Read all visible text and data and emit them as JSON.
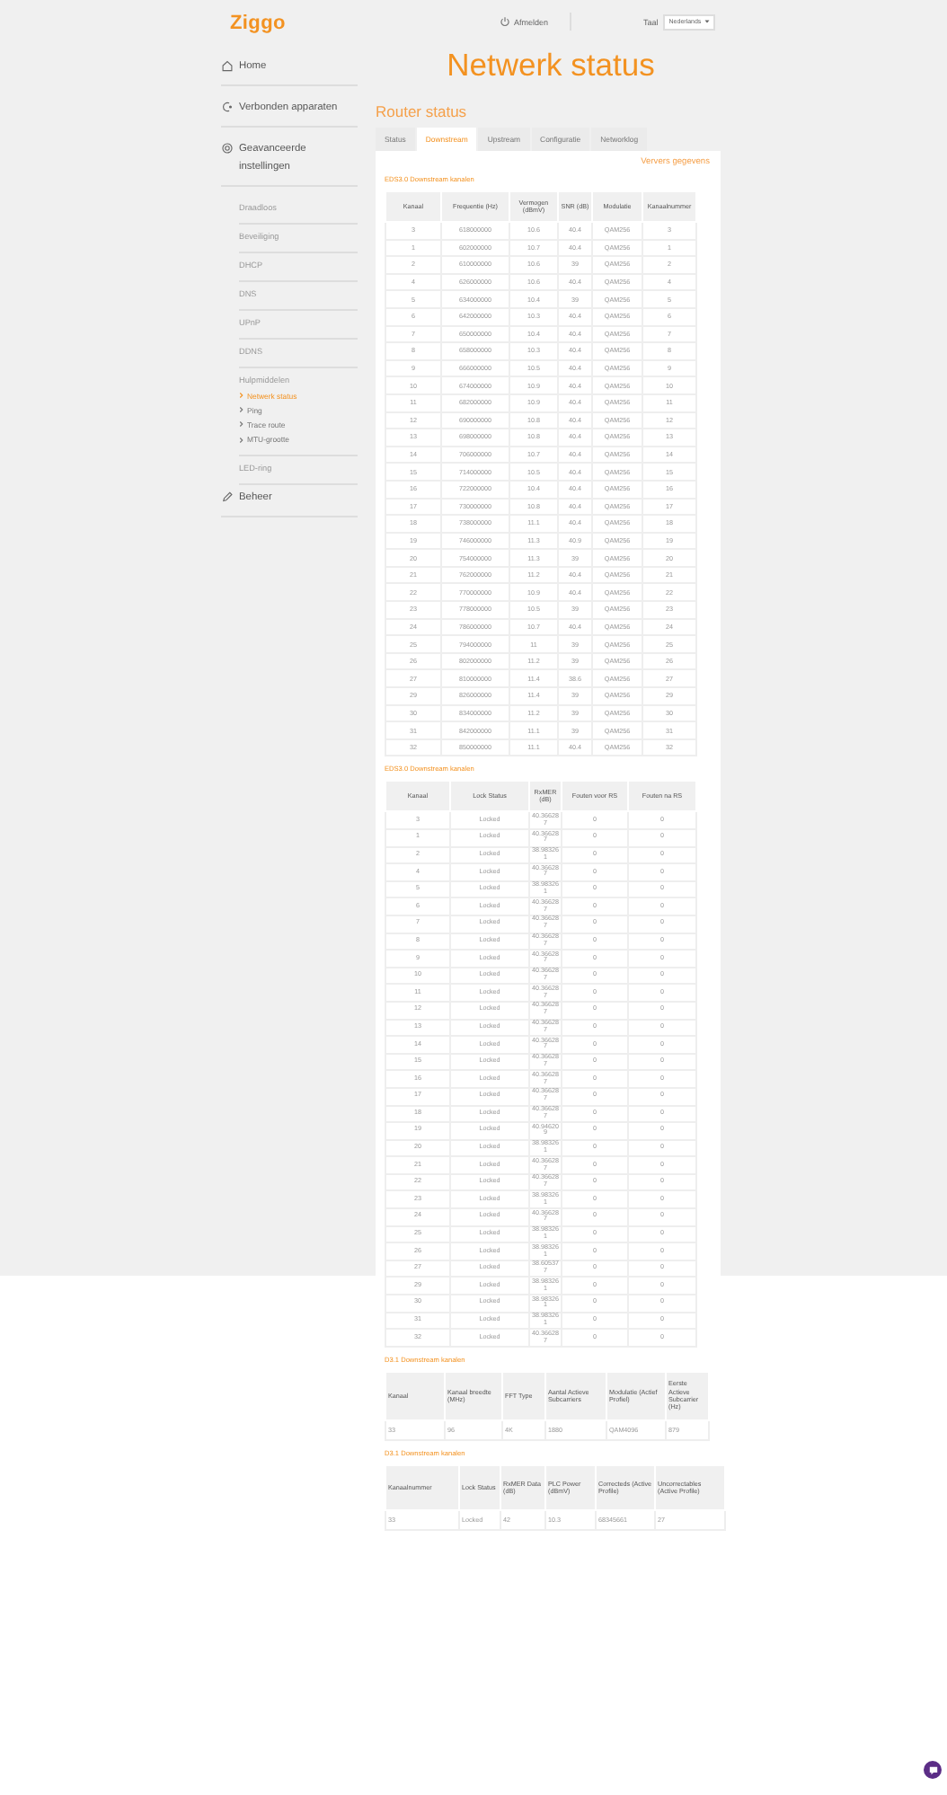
{
  "header": {
    "logo": "Ziggo",
    "logout": "Afmelden",
    "language_label": "Taal",
    "language_select": "Nederlands"
  },
  "page_title": "Netwerk status",
  "sidebar": {
    "items": [
      {
        "kind": "home",
        "label": "Home"
      },
      {
        "kind": "devices",
        "label": "Verbonden apparaten"
      },
      {
        "kind": "settings",
        "label": "Geavanceerde instellingen",
        "children": [
          {
            "kind": "page",
            "label": "Draadloos"
          },
          {
            "kind": "page",
            "label": "Beveiliging"
          },
          {
            "kind": "page",
            "label": "DHCP"
          },
          {
            "kind": "page",
            "label": "DNS"
          },
          {
            "kind": "page",
            "label": "UPnP"
          },
          {
            "kind": "page",
            "label": "DDNS"
          },
          {
            "kind": "group",
            "label": "Hulpmiddelen",
            "children": [
              {
                "kind": "tool",
                "label": "Netwerk status",
                "selected": true
              },
              {
                "kind": "tool",
                "label": "Ping",
                "selected": false
              },
              {
                "kind": "tool",
                "label": "Trace route",
                "selected": false
              },
              {
                "kind": "tool",
                "label": "MTU-grootte",
                "selected": false
              }
            ]
          },
          {
            "kind": "page",
            "label": "LED-ring"
          }
        ]
      },
      {
        "kind": "admin",
        "label": "Beheer"
      }
    ]
  },
  "section_title": "Router status",
  "tabs": [
    {
      "label": "Status",
      "selected": false
    },
    {
      "label": "Downstream",
      "selected": true
    },
    {
      "label": "Upstream",
      "selected": false
    },
    {
      "label": "Configuratie",
      "selected": false
    },
    {
      "label": "Networklog",
      "selected": false
    }
  ],
  "refresh_link": "Ververs gegevens",
  "tables": [
    {
      "title": "EDS3.0 Downstream kanalen",
      "kind": "qam",
      "columns": [
        "Kanaal",
        "Frequentie (Hz)",
        "Vermogen (dBmV)",
        "SNR (dB)",
        "Modulatie",
        "Kanaalnummer"
      ],
      "rows": [
        [
          "3",
          "618000000",
          "10.6",
          "40.4",
          "QAM256",
          "3"
        ],
        [
          "1",
          "602000000",
          "10.7",
          "40.4",
          "QAM256",
          "1"
        ],
        [
          "2",
          "610000000",
          "10.6",
          "39",
          "QAM256",
          "2"
        ],
        [
          "4",
          "626000000",
          "10.6",
          "40.4",
          "QAM256",
          "4"
        ],
        [
          "5",
          "634000000",
          "10.4",
          "39",
          "QAM256",
          "5"
        ],
        [
          "6",
          "642000000",
          "10.3",
          "40.4",
          "QAM256",
          "6"
        ],
        [
          "7",
          "650000000",
          "10.4",
          "40.4",
          "QAM256",
          "7"
        ],
        [
          "8",
          "658000000",
          "10.3",
          "40.4",
          "QAM256",
          "8"
        ],
        [
          "9",
          "666000000",
          "10.5",
          "40.4",
          "QAM256",
          "9"
        ],
        [
          "10",
          "674000000",
          "10.9",
          "40.4",
          "QAM256",
          "10"
        ],
        [
          "11",
          "682000000",
          "10.9",
          "40.4",
          "QAM256",
          "11"
        ],
        [
          "12",
          "690000000",
          "10.8",
          "40.4",
          "QAM256",
          "12"
        ],
        [
          "13",
          "698000000",
          "10.8",
          "40.4",
          "QAM256",
          "13"
        ],
        [
          "14",
          "706000000",
          "10.7",
          "40.4",
          "QAM256",
          "14"
        ],
        [
          "15",
          "714000000",
          "10.5",
          "40.4",
          "QAM256",
          "15"
        ],
        [
          "16",
          "722000000",
          "10.4",
          "40.4",
          "QAM256",
          "16"
        ],
        [
          "17",
          "730000000",
          "10.8",
          "40.4",
          "QAM256",
          "17"
        ],
        [
          "18",
          "738000000",
          "11.1",
          "40.4",
          "QAM256",
          "18"
        ],
        [
          "19",
          "746000000",
          "11.3",
          "40.9",
          "QAM256",
          "19"
        ],
        [
          "20",
          "754000000",
          "11.3",
          "39",
          "QAM256",
          "20"
        ],
        [
          "21",
          "762000000",
          "11.2",
          "40.4",
          "QAM256",
          "21"
        ],
        [
          "22",
          "770000000",
          "10.9",
          "40.4",
          "QAM256",
          "22"
        ],
        [
          "23",
          "778000000",
          "10.5",
          "39",
          "QAM256",
          "23"
        ],
        [
          "24",
          "786000000",
          "10.7",
          "40.4",
          "QAM256",
          "24"
        ],
        [
          "25",
          "794000000",
          "11",
          "39",
          "QAM256",
          "25"
        ],
        [
          "26",
          "802000000",
          "11.2",
          "39",
          "QAM256",
          "26"
        ],
        [
          "27",
          "810000000",
          "11.4",
          "38.6",
          "QAM256",
          "27"
        ],
        [
          "29",
          "826000000",
          "11.4",
          "39",
          "QAM256",
          "29"
        ],
        [
          "30",
          "834000000",
          "11.2",
          "39",
          "QAM256",
          "30"
        ],
        [
          "31",
          "842000000",
          "11.1",
          "39",
          "QAM256",
          "31"
        ],
        [
          "32",
          "850000000",
          "11.1",
          "40.4",
          "QAM256",
          "32"
        ]
      ]
    },
    {
      "title": "EDS3.0 Downstream kanalen",
      "kind": "mer",
      "columns": [
        "Kanaal",
        "Lock Status",
        "RxMER (dB)",
        "Fouten voor RS",
        "Fouten na RS"
      ],
      "rows": [
        [
          "3",
          "Locked",
          "40.366287",
          "0",
          "0"
        ],
        [
          "1",
          "Locked",
          "40.366287",
          "0",
          "0"
        ],
        [
          "2",
          "Locked",
          "38.983261",
          "0",
          "0"
        ],
        [
          "4",
          "Locked",
          "40.366287",
          "0",
          "0"
        ],
        [
          "5",
          "Locked",
          "38.983261",
          "0",
          "0"
        ],
        [
          "6",
          "Locked",
          "40.366287",
          "0",
          "0"
        ],
        [
          "7",
          "Locked",
          "40.366287",
          "0",
          "0"
        ],
        [
          "8",
          "Locked",
          "40.366287",
          "0",
          "0"
        ],
        [
          "9",
          "Locked",
          "40.366287",
          "0",
          "0"
        ],
        [
          "10",
          "Locked",
          "40.366287",
          "0",
          "0"
        ],
        [
          "11",
          "Locked",
          "40.366287",
          "0",
          "0"
        ],
        [
          "12",
          "Locked",
          "40.366287",
          "0",
          "0"
        ],
        [
          "13",
          "Locked",
          "40.366287",
          "0",
          "0"
        ],
        [
          "14",
          "Locked",
          "40.366287",
          "0",
          "0"
        ],
        [
          "15",
          "Locked",
          "40.366287",
          "0",
          "0"
        ],
        [
          "16",
          "Locked",
          "40.366287",
          "0",
          "0"
        ],
        [
          "17",
          "Locked",
          "40.366287",
          "0",
          "0"
        ],
        [
          "18",
          "Locked",
          "40.366287",
          "0",
          "0"
        ],
        [
          "19",
          "Locked",
          "40.946209",
          "0",
          "0"
        ],
        [
          "20",
          "Locked",
          "38.983261",
          "0",
          "0"
        ],
        [
          "21",
          "Locked",
          "40.366287",
          "0",
          "0"
        ],
        [
          "22",
          "Locked",
          "40.366287",
          "0",
          "0"
        ],
        [
          "23",
          "Locked",
          "38.983261",
          "0",
          "0"
        ],
        [
          "24",
          "Locked",
          "40.366287",
          "0",
          "0"
        ],
        [
          "25",
          "Locked",
          "38.983261",
          "0",
          "0"
        ],
        [
          "26",
          "Locked",
          "38.983261",
          "0",
          "0"
        ],
        [
          "27",
          "Locked",
          "38.605377",
          "0",
          "0"
        ],
        [
          "29",
          "Locked",
          "38.983261",
          "0",
          "0"
        ],
        [
          "30",
          "Locked",
          "38.983261",
          "0",
          "0"
        ],
        [
          "31",
          "Locked",
          "38.983261",
          "0",
          "0"
        ],
        [
          "32",
          "Locked",
          "40.366287",
          "0",
          "0"
        ]
      ]
    },
    {
      "title": "D3.1 Downstream kanalen",
      "kind": "ofdm",
      "columns": [
        "Kanaal",
        "Kanaal breedte (MHz)",
        "FFT Type",
        "Aantal Actieve Subcarriers",
        "Modulatie (Actief Profiel)",
        "Eerste Actieve Subcarrier (Hz)"
      ],
      "rows": [
        [
          "33",
          "96",
          "4K",
          "1880",
          "QAM4096",
          "879"
        ]
      ]
    },
    {
      "title": "D3.1 Downstream kanalen",
      "kind": "ofdm-status",
      "columns": [
        "Kanaalnummer",
        "Lock Status",
        "RxMER Data (dB)",
        "PLC Power (dBmV)",
        "Correcteds (Active Profile)",
        "Uncorrectables (Active Profile)"
      ],
      "rows": [
        [
          "33",
          "Locked",
          "42",
          "10.3",
          "68345661",
          "27"
        ]
      ]
    }
  ]
}
